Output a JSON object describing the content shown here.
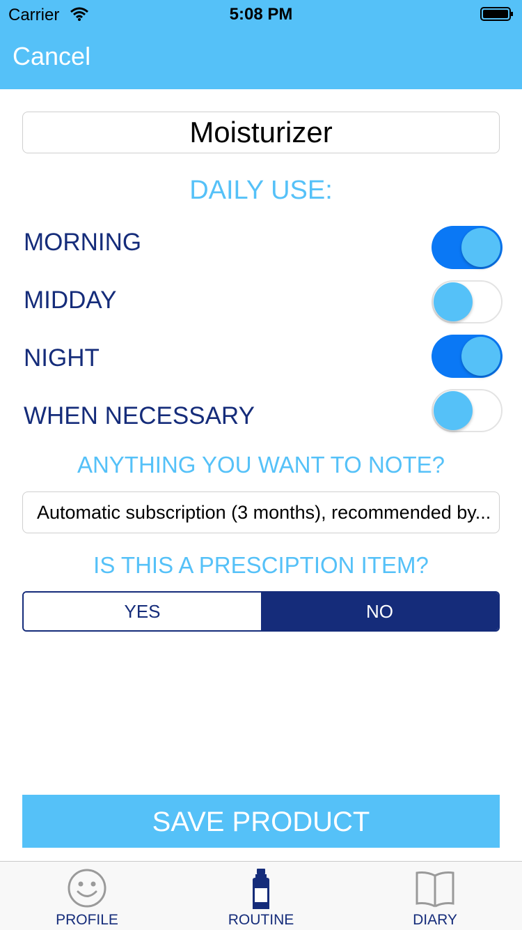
{
  "status_bar": {
    "carrier": "Carrier",
    "time": "5:08 PM"
  },
  "nav": {
    "cancel_label": "Cancel"
  },
  "product": {
    "name": "Moisturizer"
  },
  "daily_use": {
    "title": "DAILY USE:",
    "items": [
      {
        "label": "MORNING",
        "on": true
      },
      {
        "label": "MIDDAY",
        "on": false
      },
      {
        "label": "NIGHT",
        "on": true
      },
      {
        "label": "WHEN NECESSARY",
        "on": false
      }
    ]
  },
  "note": {
    "title": "ANYTHING YOU WANT TO NOTE?",
    "value": "Automatic subscription (3 months), recommended by..."
  },
  "prescription": {
    "title": "IS THIS A PRESCIPTION ITEM?",
    "options": [
      "YES",
      "NO"
    ],
    "selected": "NO"
  },
  "save_button": {
    "label": "SAVE PRODUCT"
  },
  "tabs": [
    {
      "label": "PROFILE",
      "icon": "smiley-face-icon"
    },
    {
      "label": "ROUTINE",
      "icon": "bottle-icon",
      "active": true
    },
    {
      "label": "DIARY",
      "icon": "open-book-icon"
    }
  ],
  "colors": {
    "accent": "#55c1f8",
    "navy": "#152c7a",
    "toggle_on": "#0a78f5"
  }
}
